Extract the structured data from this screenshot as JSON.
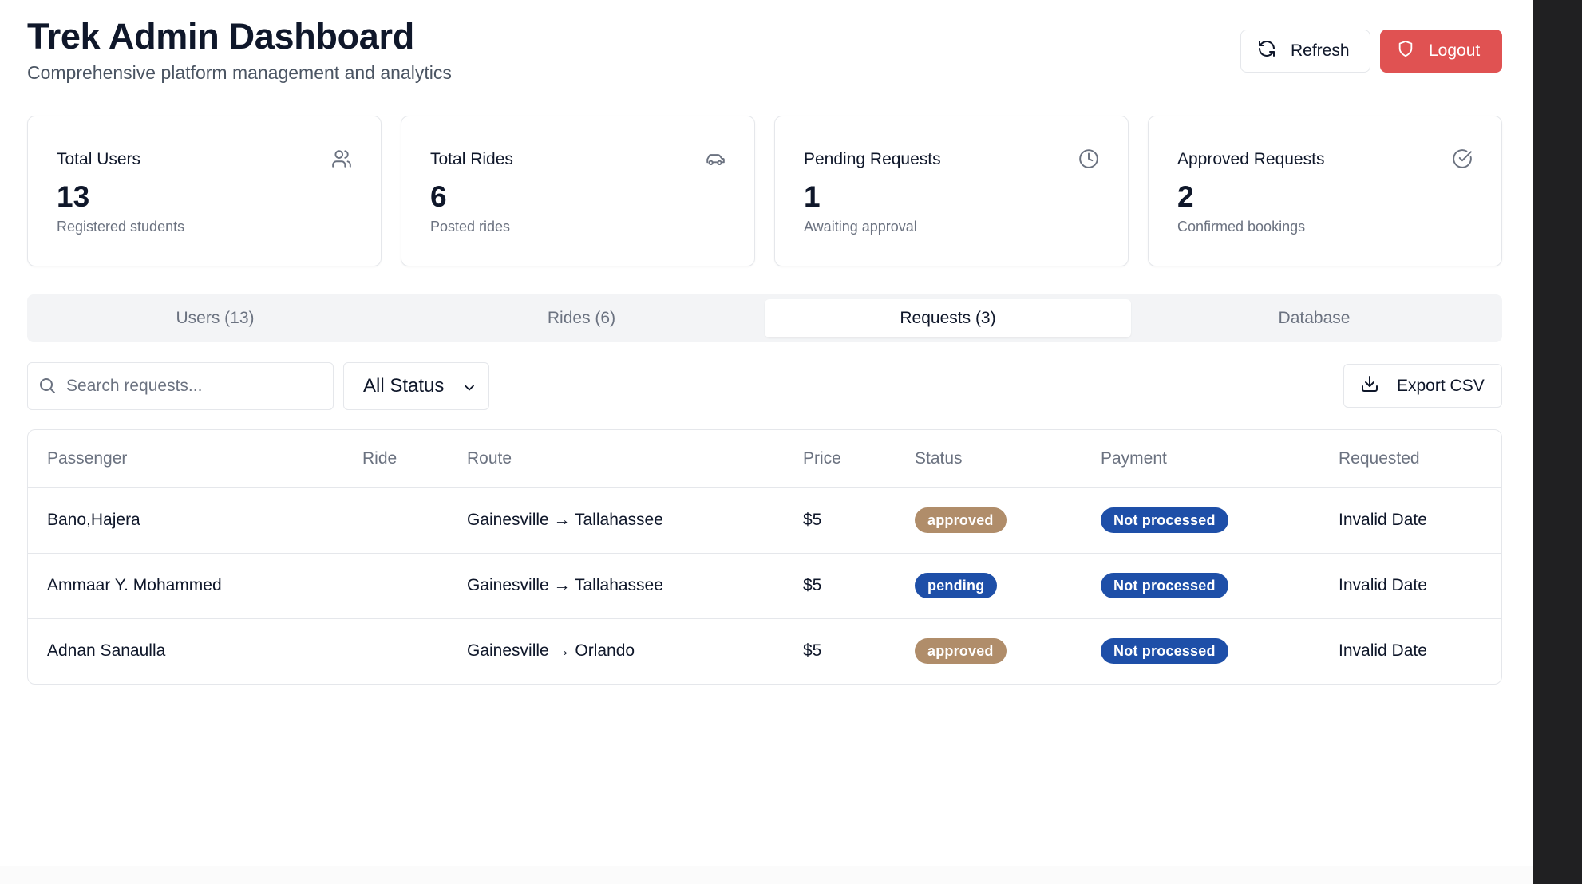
{
  "header": {
    "title": "Trek Admin Dashboard",
    "subtitle": "Comprehensive platform management and analytics",
    "refresh_label": "Refresh",
    "logout_label": "Logout"
  },
  "stats": [
    {
      "title": "Total Users",
      "value": "13",
      "sub": "Registered students",
      "icon": "users-icon"
    },
    {
      "title": "Total Rides",
      "value": "6",
      "sub": "Posted rides",
      "icon": "car-icon"
    },
    {
      "title": "Pending Requests",
      "value": "1",
      "sub": "Awaiting approval",
      "icon": "clock-icon"
    },
    {
      "title": "Approved Requests",
      "value": "2",
      "sub": "Confirmed bookings",
      "icon": "check-circle-icon"
    }
  ],
  "tabs": [
    {
      "label": "Users (13)",
      "active": false
    },
    {
      "label": "Rides (6)",
      "active": false
    },
    {
      "label": "Requests (3)",
      "active": true
    },
    {
      "label": "Database",
      "active": false
    }
  ],
  "toolbar": {
    "search_placeholder": "Search requests...",
    "status_filter": "All Status",
    "export_label": "Export CSV"
  },
  "table": {
    "columns": [
      "Passenger",
      "Ride",
      "Route",
      "Price",
      "Status",
      "Payment",
      "Requested"
    ],
    "rows": [
      {
        "passenger": "Bano,Hajera",
        "ride": "",
        "route": "Gainesville → Tallahassee",
        "price": "$5",
        "status": "approved",
        "payment": "Not processed",
        "requested": "Invalid Date"
      },
      {
        "passenger": "Ammaar Y. Mohammed",
        "ride": "",
        "route": "Gainesville → Tallahassee",
        "price": "$5",
        "status": "pending",
        "payment": "Not processed",
        "requested": "Invalid Date"
      },
      {
        "passenger": "Adnan Sanaulla",
        "ride": "",
        "route": "Gainesville → Orlando",
        "price": "$5",
        "status": "approved",
        "payment": "Not processed",
        "requested": "Invalid Date"
      }
    ]
  },
  "colors": {
    "logout_red": "#e05252",
    "approved_badge": "#b08d6a",
    "pending_badge": "#1e4fa8",
    "payment_badge": "#1e4fa8"
  }
}
